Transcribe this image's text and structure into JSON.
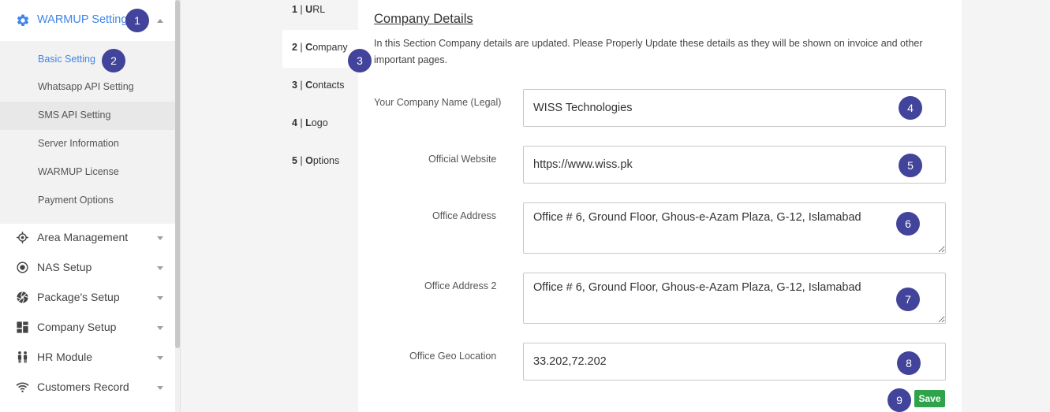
{
  "sidebar": {
    "section": {
      "label": "WARMUP Setting",
      "icon": "gear-icon"
    },
    "submenu": [
      {
        "label": "Basic Setting",
        "active": true
      },
      {
        "label": "Whatsapp API Setting"
      },
      {
        "label": "SMS API Setting",
        "hover": true
      },
      {
        "label": "Server Information"
      },
      {
        "label": "WARMUP License"
      },
      {
        "label": "Payment Options"
      }
    ],
    "items": [
      {
        "label": "Area Management",
        "icon": "target-icon"
      },
      {
        "label": "NAS Setup",
        "icon": "radio-button-icon"
      },
      {
        "label": "Package's Setup",
        "icon": "aperture-icon"
      },
      {
        "label": "Company Setup",
        "icon": "dashboard-icon"
      },
      {
        "label": "HR Module",
        "icon": "people-icon"
      },
      {
        "label": "Customers Record",
        "icon": "wifi-icon"
      }
    ]
  },
  "steps": [
    {
      "num": "1",
      "sep": " | ",
      "initial": "U",
      "rest": "RL"
    },
    {
      "num": "2",
      "sep": " | ",
      "initial": "C",
      "rest": "ompany",
      "active": true
    },
    {
      "num": "3",
      "sep": " | ",
      "initial": "C",
      "rest": "ontacts"
    },
    {
      "num": "4",
      "sep": " | ",
      "initial": "L",
      "rest": "ogo"
    },
    {
      "num": "5",
      "sep": " | ",
      "initial": "O",
      "rest": "ptions"
    }
  ],
  "panel": {
    "title": "Company Details",
    "description": "In this Section Company details are updated. Please Properly Update these details as they will be shown on invoice and other important pages.",
    "fields": {
      "company_name": {
        "label": "Your Company Name (Legal)",
        "value": "WISS Technologies"
      },
      "website": {
        "label": "Official Website",
        "value": "https://www.wiss.pk"
      },
      "address": {
        "label": "Office Address",
        "value": "Office # 6, Ground Floor, Ghous-e-Azam Plaza, G-12, Islamabad"
      },
      "address2": {
        "label": "Office Address 2",
        "value": "Office # 6, Ground Floor, Ghous-e-Azam Plaza, G-12, Islamabad"
      },
      "geo": {
        "label": "Office Geo Location",
        "value": "33.202,72.202"
      }
    },
    "save_label": "Save"
  },
  "badges": [
    "1",
    "2",
    "3",
    "4",
    "5",
    "6",
    "7",
    "8",
    "9"
  ],
  "colors": {
    "accent": "#3f86e6",
    "badge": "#42439a",
    "save": "#2ea34c"
  }
}
